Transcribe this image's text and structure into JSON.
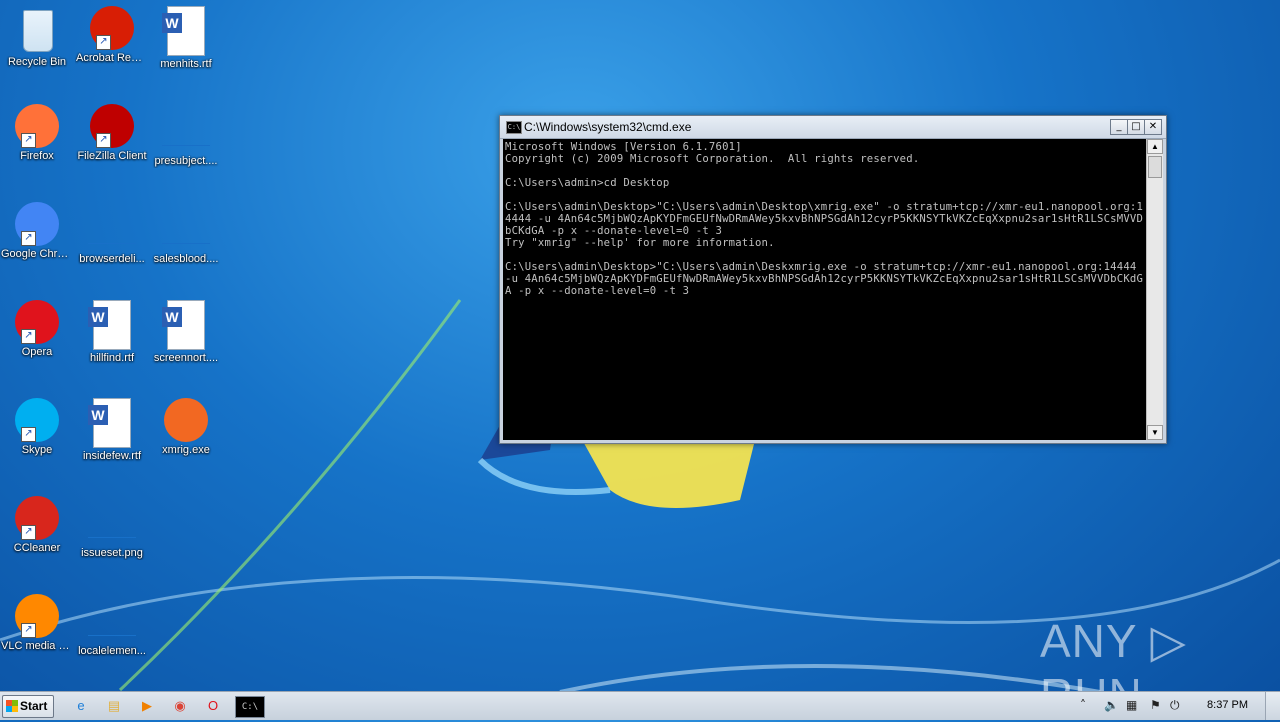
{
  "desktop": {
    "icons": [
      {
        "label": "Recycle Bin",
        "icon": "recycle-bin-icon",
        "color": "#cfe3f2"
      },
      {
        "label": "Acrobat Reader DC",
        "icon": "acrobat-icon",
        "color": "#d81e05"
      },
      {
        "label": "menhits.rtf",
        "icon": "word-document-icon",
        "color": "#2b5fb3"
      },
      {
        "label": "Firefox",
        "icon": "firefox-icon",
        "color": "#ff7139"
      },
      {
        "label": "FileZilla Client",
        "icon": "filezilla-icon",
        "color": "#bf0000"
      },
      {
        "label": "presubject....",
        "icon": "blank-file-icon",
        "color": "#1870c8"
      },
      {
        "label": "Google Chrome",
        "icon": "chrome-icon",
        "color": "#4285f4"
      },
      {
        "label": "browserdeli...",
        "icon": "blank-file-icon",
        "color": "#1870c8"
      },
      {
        "label": "salesblood....",
        "icon": "blank-file-icon",
        "color": "#1870c8"
      },
      {
        "label": "Opera",
        "icon": "opera-icon",
        "color": "#e0131c"
      },
      {
        "label": "hillfind.rtf",
        "icon": "word-document-icon",
        "color": "#2b5fb3"
      },
      {
        "label": "screennort....",
        "icon": "word-document-icon",
        "color": "#2b5fb3"
      },
      {
        "label": "Skype",
        "icon": "skype-icon",
        "color": "#00aff0"
      },
      {
        "label": "insidefew.rtf",
        "icon": "word-document-icon",
        "color": "#2b5fb3"
      },
      {
        "label": "xmrig.exe",
        "icon": "monero-icon",
        "color": "#f26822"
      },
      {
        "label": "CCleaner",
        "icon": "ccleaner-icon",
        "color": "#d8261c"
      },
      {
        "label": "issueset.png",
        "icon": "blank-file-icon",
        "color": "#1870c8"
      },
      {
        "label": "VLC media player",
        "icon": "vlc-icon",
        "color": "#ff8800"
      },
      {
        "label": "localelemen...",
        "icon": "blank-file-icon",
        "color": "#1870c8"
      }
    ]
  },
  "cmd": {
    "title": "C:\\Windows\\system32\\cmd.exe",
    "icon_text": "C:\\",
    "minimize": "_",
    "maximize": "□",
    "close": "✕",
    "output": "Microsoft Windows [Version 6.1.7601]\nCopyright (c) 2009 Microsoft Corporation.  All rights reserved.\n\nC:\\Users\\admin>cd Desktop\n\nC:\\Users\\admin\\Desktop>\"C:\\Users\\admin\\Desktop\\xmrig.exe\" -o stratum+tcp://xmr-eu1.nanopool.org:14444 -u 4An64c5MjbWQzApKYDFmGEUfNwDRmAWey5kxvBhNPSGdAh12cyrP5KKNSYTkVKZcEqXxpnu2sar1sHtR1LSCsMVVDbCKdGA -p x --donate-level=0 -t 3\nTry \"xmrig\" --help' for more information.\n\nC:\\Users\\admin\\Desktop>\"C:\\Users\\admin\\Deskxmrig.exe -o stratum+tcp://xmr-eu1.nanopool.org:14444 -u 4An64c5MjbWQzApKYDFmGEUfNwDRmAWey5kxvBhNPSGdAh12cyrP5KKNSYTkVKZcEqXxpnu2sar1sHtR1LSCsMVVDbCKdGA -p x --donate-level=0 -t 3"
  },
  "watermark": "ANY ▷ RUN",
  "taskbar": {
    "start_label": "Start",
    "clock": "8:37 PM",
    "pinned": [
      {
        "icon": "internet-explorer-icon",
        "glyph": "e",
        "color": "#1e7fd8"
      },
      {
        "icon": "explorer-folder-icon",
        "glyph": "▤",
        "color": "#e0b040"
      },
      {
        "icon": "media-player-icon",
        "glyph": "▶",
        "color": "#f08000"
      },
      {
        "icon": "chrome-icon",
        "glyph": "◉",
        "color": "#db4437"
      },
      {
        "icon": "opera-icon",
        "glyph": "O",
        "color": "#e0131c"
      },
      {
        "icon": "cmd-icon",
        "glyph": "C:\\",
        "color": "#000000"
      }
    ],
    "tray": [
      {
        "icon": "chevron-up-icon",
        "glyph": "˄"
      },
      {
        "icon": "volume-icon",
        "glyph": "🔈"
      },
      {
        "icon": "network-icon",
        "glyph": "▦"
      },
      {
        "icon": "flag-icon",
        "glyph": "⚑"
      },
      {
        "icon": "power-icon",
        "glyph": "⏻"
      }
    ]
  }
}
